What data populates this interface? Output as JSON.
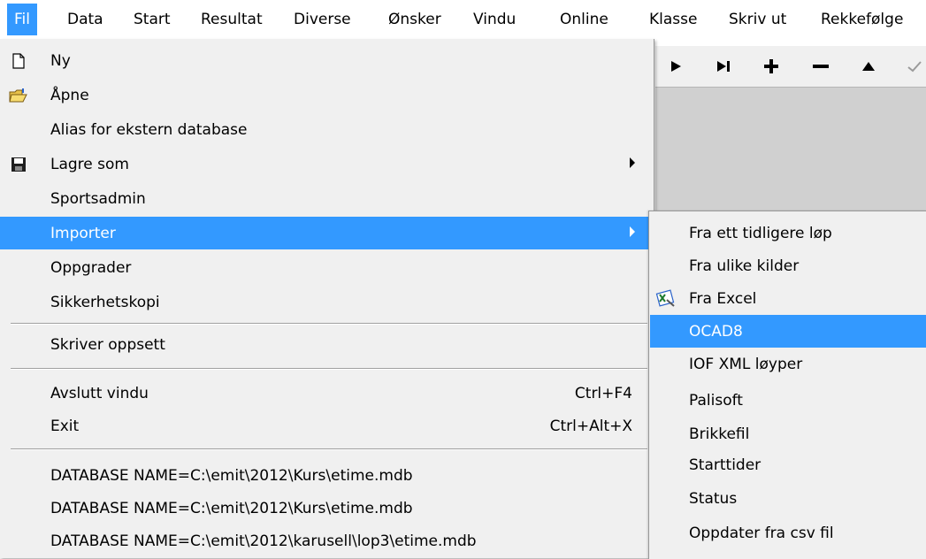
{
  "menubar": {
    "items": [
      {
        "label": "Fil",
        "active": true
      },
      {
        "label": "Data"
      },
      {
        "label": "Start"
      },
      {
        "label": "Resultat"
      },
      {
        "label": "Diverse"
      },
      {
        "label": "Ønsker"
      },
      {
        "label": "Vindu"
      },
      {
        "label": "Online"
      },
      {
        "label": "Klasse"
      },
      {
        "label": "Skriv ut"
      },
      {
        "label": "Rekkefølge"
      }
    ]
  },
  "toolbar": {
    "icons": [
      "play-icon",
      "skip-end-icon",
      "plus-icon",
      "minus-icon",
      "triangle-up-icon",
      "check-icon"
    ]
  },
  "file_menu": {
    "items": [
      {
        "label": "Ny",
        "icon": "new-file-icon"
      },
      {
        "label": "Åpne",
        "icon": "open-folder-icon"
      },
      {
        "label": "Alias for ekstern database"
      },
      {
        "label": "Lagre som",
        "icon": "floppy-disk-icon",
        "submenu": true
      },
      {
        "label": "Sportsadmin"
      },
      {
        "label": "Importer",
        "submenu": true,
        "highlighted": true
      },
      {
        "label": "Oppgrader"
      },
      {
        "label": "Sikkerhetskopi"
      },
      {
        "label": "Skriver oppsett"
      },
      {
        "label": "Avslutt vindu",
        "shortcut": "Ctrl+F4"
      },
      {
        "label": "Exit",
        "shortcut": "Ctrl+Alt+X"
      },
      {
        "label": "DATABASE NAME=C:\\emit\\2012\\Kurs\\etime.mdb"
      },
      {
        "label": "DATABASE NAME=C:\\emit\\2012\\Kurs\\etime.mdb"
      },
      {
        "label": "DATABASE NAME=C:\\emit\\2012\\karusell\\lop3\\etime.mdb"
      }
    ]
  },
  "import_submenu": {
    "items": [
      {
        "label": "Fra ett tidligere løp"
      },
      {
        "label": "Fra ulike kilder"
      },
      {
        "label": "Fra Excel",
        "icon": "excel-icon"
      },
      {
        "label": "OCAD8",
        "highlighted": true
      },
      {
        "label": "IOF XML løyper"
      },
      {
        "label": "Palisoft"
      },
      {
        "label": "Brikkefil"
      },
      {
        "label": "Starttider"
      },
      {
        "label": "Status"
      },
      {
        "label": "Oppdater fra csv fil"
      }
    ]
  },
  "colors": {
    "highlight": "#3399ff",
    "menu_bg": "#f0f0f0",
    "client_bg": "#d0d0d0"
  }
}
